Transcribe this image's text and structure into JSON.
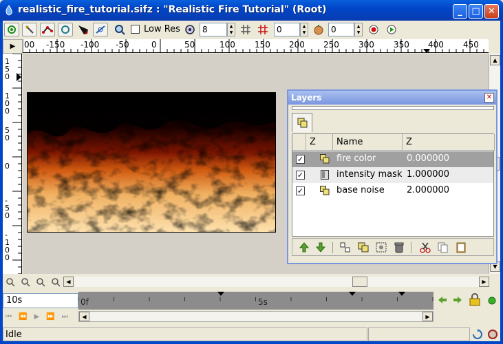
{
  "window": {
    "title": "realistic_fire_tutorial.sifz : \"Realistic Fire Tutorial\" (Root)",
    "minimize": "_",
    "maximize": "□",
    "close": "✕"
  },
  "toolbar": {
    "low_res_label": "Low Res",
    "quality_value": "8",
    "onion_past_value": "0",
    "onion_future_value": "0"
  },
  "ruler": {
    "h_labels": [
      "00",
      "-150",
      "-100",
      "-50",
      "0",
      "50",
      "100",
      "150",
      "200",
      "250",
      "300",
      "350",
      "400",
      "450"
    ],
    "v_labels": [
      "150",
      "100",
      "50",
      "0",
      "-50",
      "-100"
    ]
  },
  "layers_panel": {
    "title": "Layers",
    "columns": {
      "z": "Z",
      "name": "Name",
      "zval": "Z"
    },
    "rows": [
      {
        "checked": true,
        "icon": "group-layer-icon",
        "name": "fire color",
        "z": "0.000000"
      },
      {
        "checked": true,
        "icon": "layer-icon",
        "name": "intensity mask",
        "z": "1.000000"
      },
      {
        "checked": true,
        "icon": "group-layer-icon",
        "name": "base noise",
        "z": "2.000000"
      }
    ]
  },
  "timebar": {
    "end_time": "10s",
    "ticks": [
      "0f",
      "5s"
    ]
  },
  "status": {
    "text": "Idle"
  },
  "colors": {
    "title_bar": "#0046c8",
    "panel_border": "#7a96df",
    "selected_row": "#a0a0a0"
  }
}
